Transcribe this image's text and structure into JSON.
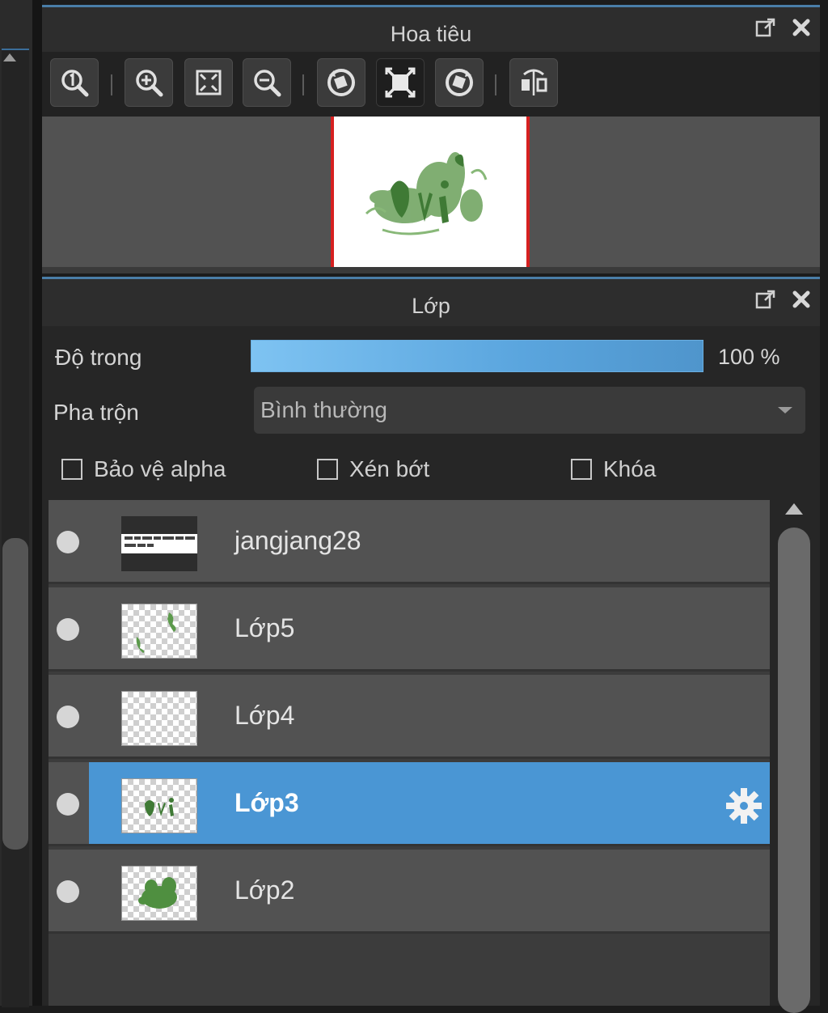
{
  "navigator": {
    "title": "Hoa tiêu",
    "toolbar": [
      "zoom-actual-icon",
      "zoom-in-icon",
      "fit-window-icon",
      "zoom-out-icon",
      "rotate-left-icon",
      "fit-canvas-icon",
      "rotate-right-icon",
      "flip-horizontal-icon"
    ]
  },
  "layers_panel": {
    "title": "Lớp",
    "opacity_label": "Độ trong",
    "opacity_value": "100 %",
    "blend_label": "Pha trộn",
    "blend_value": "Bình thường",
    "protect_alpha_label": "Bảo vệ alpha",
    "clipping_label": "Xén bớt",
    "lock_label": "Khóa",
    "layers": [
      {
        "name": "jangjang28",
        "selected": false
      },
      {
        "name": "Lớp5",
        "selected": false
      },
      {
        "name": "Lớp4",
        "selected": false
      },
      {
        "name": "Lớp3",
        "selected": true
      },
      {
        "name": "Lớp2",
        "selected": false
      }
    ]
  },
  "colors": {
    "accent": "#4a96d4",
    "panel_header_border": "#4a7ea8",
    "nav_frame": "#d62020"
  }
}
